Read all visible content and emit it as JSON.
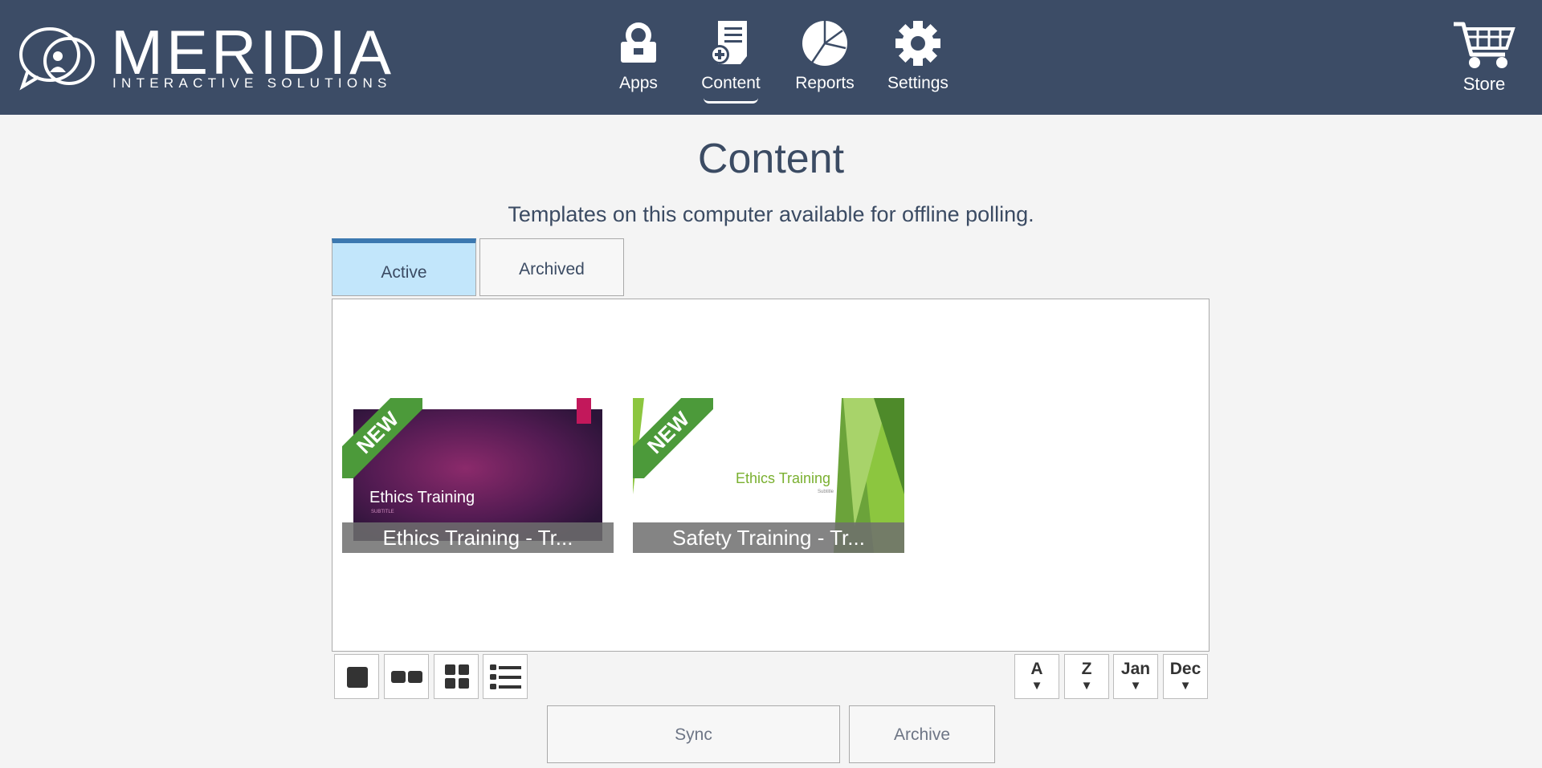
{
  "header": {
    "brand_name": "MERIDIA",
    "brand_tagline": "INTERACTIVE SOLUTIONS",
    "nav": [
      {
        "label": "Apps",
        "icon": "apps-icon"
      },
      {
        "label": "Content",
        "icon": "content-icon",
        "active": true
      },
      {
        "label": "Reports",
        "icon": "reports-icon"
      },
      {
        "label": "Settings",
        "icon": "settings-icon"
      }
    ],
    "store_label": "Store"
  },
  "main": {
    "title": "Content",
    "subtitle": "Templates on this computer available for offline polling.",
    "tabs": [
      {
        "label": "Active",
        "active": true
      },
      {
        "label": "Archived",
        "active": false
      }
    ],
    "cards": [
      {
        "caption": "Ethics Training - Tr...",
        "badge": "NEW",
        "thumb_title": "Ethics Training",
        "thumb_sub": "SUBTITLE"
      },
      {
        "caption": "Safety Training - Tr...",
        "badge": "NEW",
        "thumb_title": "Ethics Training",
        "thumb_sub": "Subtitle"
      }
    ]
  },
  "toolbar": {
    "view_modes": [
      "single-view-icon",
      "double-view-icon",
      "grid-view-icon",
      "list-view-icon"
    ],
    "sort": [
      {
        "label": "A",
        "arrow": "▼"
      },
      {
        "label": "Z",
        "arrow": "▼"
      },
      {
        "label": "Jan",
        "arrow": "▼"
      },
      {
        "label": "Dec",
        "arrow": "▼"
      }
    ]
  },
  "actions": {
    "sync_label": "Sync",
    "archive_label": "Archive"
  },
  "colors": {
    "header_bg": "#3c4c66",
    "active_tab_bg": "#c2e6fb",
    "active_tab_accent": "#3c78b0",
    "new_badge": "#4c9a3a"
  }
}
